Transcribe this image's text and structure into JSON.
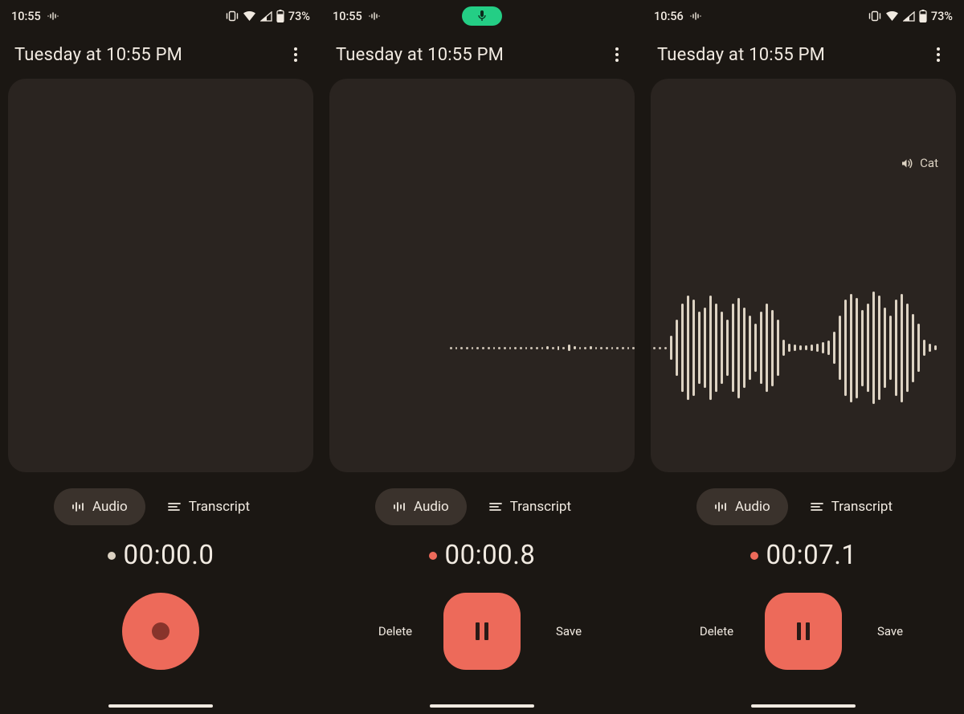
{
  "screens": [
    {
      "status": {
        "time": "10:55",
        "battery": "73%",
        "mic_chip": false
      },
      "title": "Tuesday at 10:55 PM",
      "sound_label": null,
      "waveform": false,
      "tabs": {
        "audio": "Audio",
        "transcript": "Transcript"
      },
      "timer": {
        "text": "00:00.0",
        "recording": false
      },
      "controls": {
        "mode": "record",
        "delete": null,
        "save": null
      }
    },
    {
      "status": {
        "time": "10:55",
        "battery": "",
        "mic_chip": true
      },
      "title": "Tuesday at 10:55 PM",
      "sound_label": null,
      "waveform": "short",
      "tabs": {
        "audio": "Audio",
        "transcript": "Transcript"
      },
      "timer": {
        "text": "00:00.8",
        "recording": true
      },
      "controls": {
        "mode": "pause",
        "delete": "Delete",
        "save": "Save"
      }
    },
    {
      "status": {
        "time": "10:56",
        "battery": "73%",
        "mic_chip": false
      },
      "title": "Tuesday at 10:55 PM",
      "sound_label": "Cat",
      "waveform": "full",
      "tabs": {
        "audio": "Audio",
        "transcript": "Transcript"
      },
      "timer": {
        "text": "00:07.1",
        "recording": true
      },
      "controls": {
        "mode": "pause",
        "delete": "Delete",
        "save": "Save"
      }
    }
  ]
}
